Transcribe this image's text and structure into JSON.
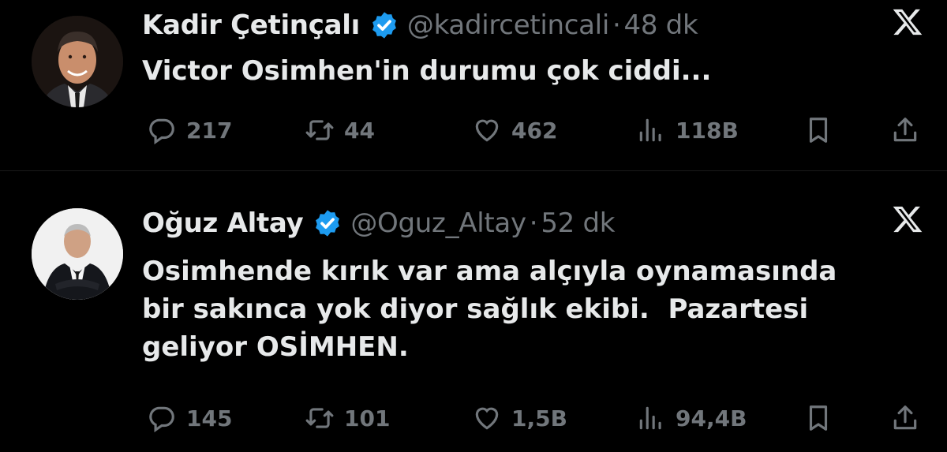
{
  "tweets": [
    {
      "name": "Kadir Çetinçalı",
      "handle": "@kadircetincali",
      "separator": "·",
      "time": "48 dk",
      "text": "Victor Osimhen'in durumu çok ciddi...",
      "replies": "217",
      "retweets": "44",
      "likes": "462",
      "views": "118B"
    },
    {
      "name": "Oğuz Altay",
      "handle": "@Oguz_Altay",
      "separator": "·",
      "time": "52 dk",
      "text": "Osimhende kırık var ama alçıyla oynamasında\nbir sakınca yok diyor sağlık ekibi.  Pazartesi\ngeliyor OSİMHEN.",
      "replies": "145",
      "retweets": "101",
      "likes": "1,5B",
      "views": "94,4B"
    }
  ],
  "colors": {
    "background": "#000000",
    "text": "#e7e9ea",
    "muted": "#71767b",
    "verified": "#1d9bf0"
  },
  "icons": [
    "reply-icon",
    "retweet-icon",
    "like-icon",
    "views-icon",
    "bookmark-icon",
    "share-icon",
    "verified-badge-icon",
    "x-logo-icon"
  ]
}
